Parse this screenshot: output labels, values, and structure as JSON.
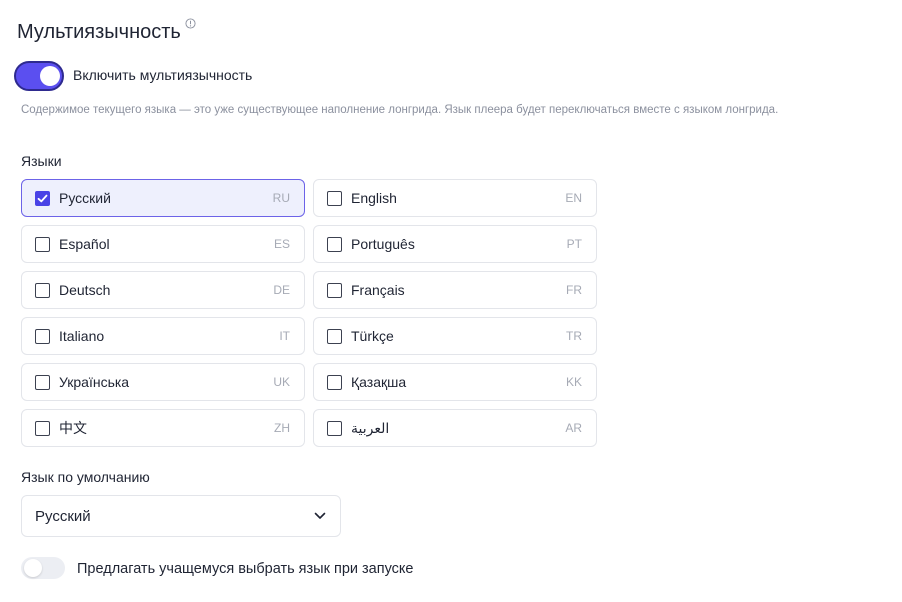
{
  "header": {
    "title": "Мультиязычность",
    "info_icon": "info-icon"
  },
  "multilang_toggle": {
    "label": "Включить мультиязычность",
    "enabled": true,
    "accent_color": "#5b4ff0"
  },
  "hint": "Содержимое текущего языка — это уже существующее наполнение лонгрида. Язык плеера будет переключаться вместе с языком лонгрида.",
  "languages": {
    "label": "Языки",
    "items": [
      {
        "name": "Русский",
        "code": "RU",
        "checked": true
      },
      {
        "name": "English",
        "code": "EN",
        "checked": false
      },
      {
        "name": "Español",
        "code": "ES",
        "checked": false
      },
      {
        "name": "Português",
        "code": "PT",
        "checked": false
      },
      {
        "name": "Deutsch",
        "code": "DE",
        "checked": false
      },
      {
        "name": "Français",
        "code": "FR",
        "checked": false
      },
      {
        "name": "Italiano",
        "code": "IT",
        "checked": false
      },
      {
        "name": "Türkçe",
        "code": "TR",
        "checked": false
      },
      {
        "name": "Українська",
        "code": "UK",
        "checked": false
      },
      {
        "name": "Қазақша",
        "code": "KK",
        "checked": false
      },
      {
        "name": "中文",
        "code": "ZH",
        "checked": false
      },
      {
        "name": "العربية",
        "code": "AR",
        "checked": false
      }
    ]
  },
  "default_language": {
    "label": "Язык по умолчанию",
    "selected": "Русский",
    "icon": "chevron-down-icon"
  },
  "prompt_toggle": {
    "label": "Предлагать учащемуся выбрать язык при запуске",
    "enabled": false
  }
}
